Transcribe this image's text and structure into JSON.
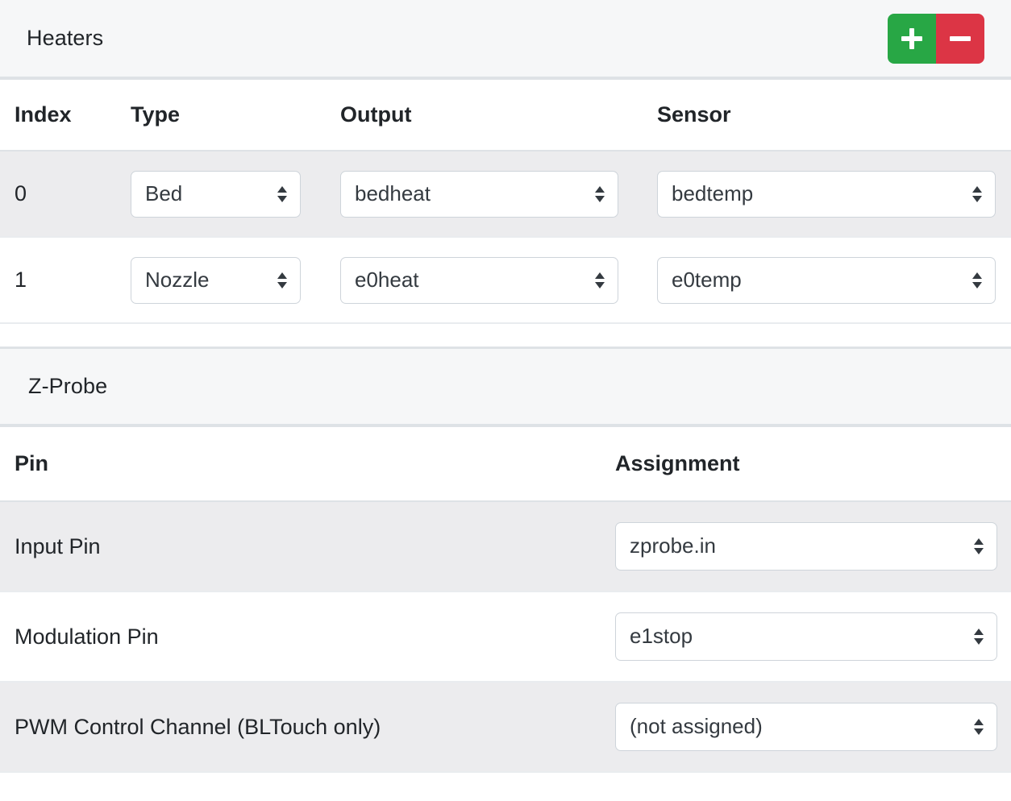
{
  "heaters_card": {
    "title": "Heaters",
    "add_button": {
      "label": "+",
      "icon": "plus-icon",
      "color": "#28a745"
    },
    "remove_button": {
      "label": "−",
      "icon": "minus-icon",
      "color": "#dc3545"
    },
    "columns": [
      "Index",
      "Type",
      "Output",
      "Sensor"
    ],
    "rows": [
      {
        "index": "0",
        "type": "Bed",
        "output": "bedheat",
        "sensor": "bedtemp"
      },
      {
        "index": "1",
        "type": "Nozzle",
        "output": "e0heat",
        "sensor": "e0temp"
      }
    ]
  },
  "zprobe_card": {
    "title": "Z-Probe",
    "columns": [
      "Pin",
      "Assignment"
    ],
    "rows": [
      {
        "pin": "Input Pin",
        "assignment": "zprobe.in"
      },
      {
        "pin": "Modulation Pin",
        "assignment": "e1stop"
      },
      {
        "pin": "PWM Control Channel (BLTouch only)",
        "assignment": "(not assigned)"
      }
    ]
  },
  "icons": {
    "select_arrows": "chevron-up-down-icon"
  }
}
